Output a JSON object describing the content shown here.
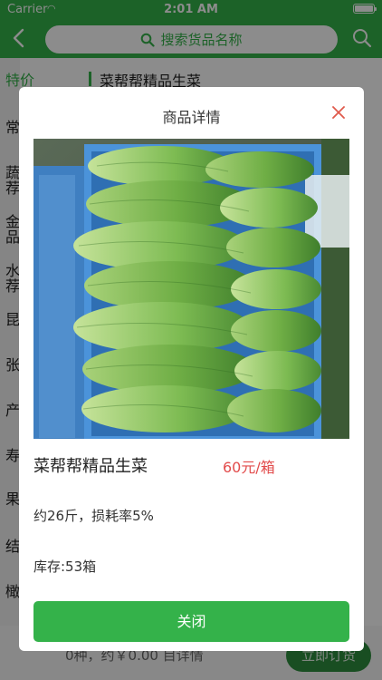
{
  "status_bar": {
    "carrier": "Carrier",
    "time": "2:01 AM"
  },
  "nav": {
    "search_placeholder": "搜索货品名称",
    "back_icon": "chevron-left-icon",
    "search_icon": "search-icon"
  },
  "sidebar": {
    "items": [
      {
        "label": "特价"
      },
      {
        "label": "常"
      },
      {
        "label": "蔬荐"
      },
      {
        "label": "金品"
      },
      {
        "label": "水荐"
      },
      {
        "label": "昆"
      },
      {
        "label": "张"
      },
      {
        "label": "产"
      },
      {
        "label": "寿"
      },
      {
        "label": "果"
      },
      {
        "label": "结"
      },
      {
        "label": "橄"
      }
    ]
  },
  "content": {
    "section_title": "菜帮帮精品生菜"
  },
  "bottom_bar": {
    "summary": "0种，约￥0.00 目详情",
    "order_button": "立即订货"
  },
  "modal": {
    "title": "商品详情",
    "close_icon": "close-icon",
    "product": {
      "name": "菜帮帮精品生菜",
      "price": "60元/箱",
      "spec": "约26斤，损耗率5%",
      "stock": "库存:53箱"
    },
    "close_button": "关闭"
  },
  "colors": {
    "brand_green": "#34b24a",
    "price_red": "#e24c4c",
    "close_x": "#e05a4c"
  }
}
